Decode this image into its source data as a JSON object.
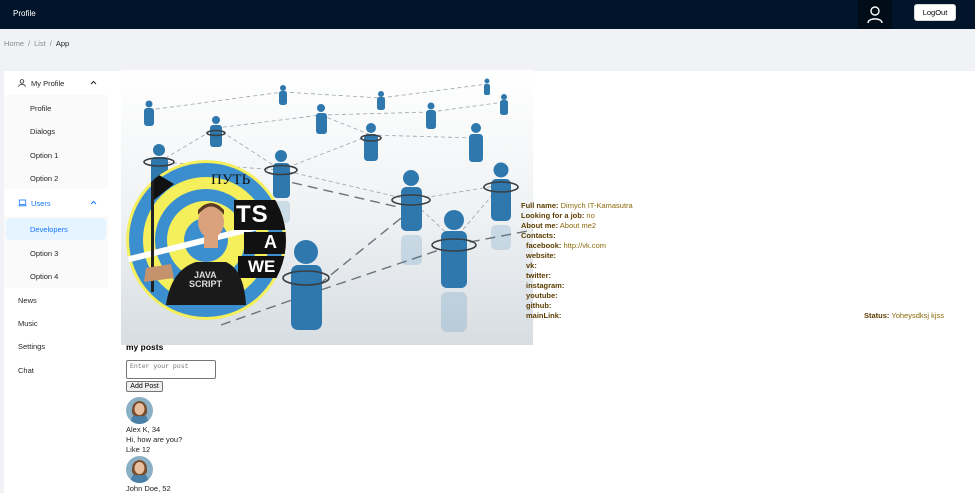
{
  "header": {
    "title": "Profile",
    "logout_label": "LogOut"
  },
  "breadcrumb": [
    "Home",
    "List",
    "App"
  ],
  "sidebar": {
    "groups": [
      {
        "label": "My Profile",
        "items": [
          "Profile",
          "Dialogs",
          "Option 1",
          "Option 2"
        ]
      },
      {
        "label": "Users",
        "items": [
          "Developers",
          "Option 3",
          "Option 4"
        ]
      }
    ],
    "plain_items": [
      "News",
      "Music",
      "Settings",
      "Chat"
    ]
  },
  "profile": {
    "full_name_label": "Full name:",
    "full_name": "Dimych IT-Kamasutra",
    "job_label": "Looking for a job:",
    "job": "no",
    "about_label": "About me:",
    "about": "About me2",
    "contacts_label": "Contacts:",
    "contacts": [
      {
        "label": "facebook:",
        "value": "http://vk.com"
      },
      {
        "label": "website:",
        "value": ""
      },
      {
        "label": "vk:",
        "value": ""
      },
      {
        "label": "twitter:",
        "value": ""
      },
      {
        "label": "instagram:",
        "value": ""
      },
      {
        "label": "youtube:",
        "value": ""
      },
      {
        "label": "github:",
        "value": ""
      },
      {
        "label": "mainLink:",
        "value": ""
      }
    ],
    "status_label": "Status:",
    "status": "Yoheysdksj kjss",
    "avatar_text": {
      "put": "ПУТЬ",
      "ts": "TS",
      "a": "A",
      "we": "WE",
      "shirt_line1": "JAVA",
      "shirt_line2": "SCRIPT"
    }
  },
  "posts": {
    "title": "my posts",
    "input_placeholder": "Enter your post",
    "add_label": "Add Post",
    "items": [
      {
        "author": "Alex K, 34",
        "text": "Hi, how are you?",
        "likes": "Like 12"
      },
      {
        "author": "John Doe, 52",
        "text": "",
        "likes": ""
      }
    ]
  },
  "colors": {
    "header_bg": "#001529",
    "accent": "#1677ff",
    "selected_bg": "#e6f4ff",
    "info_value": "#8b6a0a",
    "info_key": "#5c3d00"
  }
}
